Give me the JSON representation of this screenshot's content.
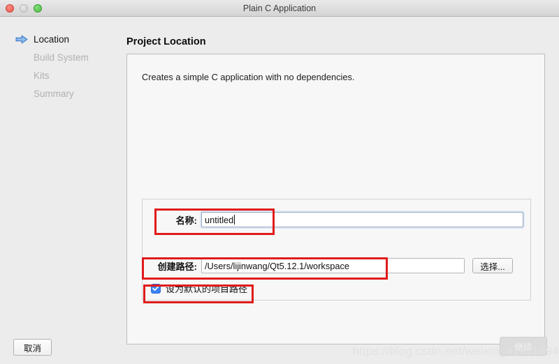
{
  "window": {
    "title": "Plain C Application",
    "traffic_lights": [
      "close-button",
      "minimize-button",
      "zoom-button"
    ]
  },
  "sidebar": {
    "items": [
      {
        "label": "Location",
        "state": "active",
        "icon": "blue-arrow-icon"
      },
      {
        "label": "Build System",
        "state": "disabled",
        "icon": ""
      },
      {
        "label": "Kits",
        "state": "disabled",
        "icon": ""
      },
      {
        "label": "Summary",
        "state": "disabled",
        "icon": ""
      }
    ]
  },
  "main": {
    "page_title": "Project Location",
    "description": "Creates a simple C application with no dependencies.",
    "form": {
      "name_label": "名称:",
      "name_value": "untitled",
      "name_placeholder": "",
      "path_label": "创建路径:",
      "path_value": "/Users/lijinwang/Qt5.12.1/workspace",
      "path_placeholder": "",
      "browse_label": "选择...",
      "checkbox_label": "设为默认的项目路径",
      "checkbox_checked": true
    }
  },
  "footer": {
    "cancel_label": "取消",
    "continue_label": "继续",
    "continue_enabled": false
  },
  "watermark": {
    "text": "https://blog.csdn.net/weixin_41911694"
  },
  "colors": {
    "accent_blue": "#3a82f6",
    "annotation_red": "#e01b1b",
    "window_bg": "#ececec",
    "panel_bg": "#f7f7f7",
    "disabled_text": "#b0b0b0"
  }
}
